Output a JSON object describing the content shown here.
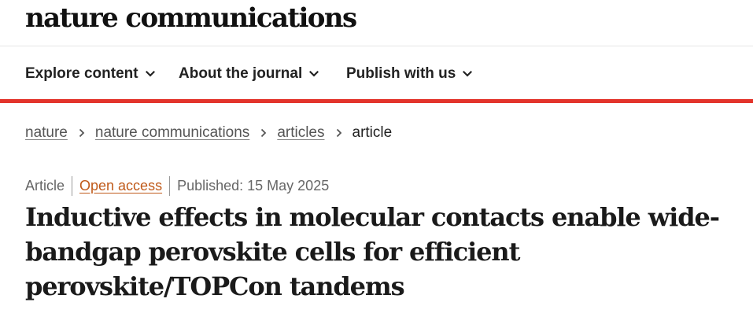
{
  "site": {
    "logo_text": "nature communications"
  },
  "nav": {
    "items": [
      {
        "label": "Explore content",
        "icon": "chevron-down-icon"
      },
      {
        "label": "About the journal",
        "icon": "chevron-down-icon"
      },
      {
        "label": "Publish with us",
        "icon": "chevron-down-icon"
      }
    ]
  },
  "breadcrumb": {
    "items": [
      {
        "label": "nature"
      },
      {
        "label": "nature communications"
      },
      {
        "label": "articles"
      },
      {
        "label": "article"
      }
    ],
    "separator_icon": "chevron-right-icon"
  },
  "article": {
    "type": "Article",
    "access": "Open access",
    "published": "Published: 15 May 2025",
    "title_lines": [
      "Inductive effects in molecular contacts enable wide-",
      "bandgap perovskite cells for efficient",
      "perovskite/TOPCon tandems"
    ]
  },
  "colors": {
    "accent_bar": "#e3342b",
    "open_access": "#c05a1a",
    "text": "#222222",
    "muted": "#666666"
  }
}
